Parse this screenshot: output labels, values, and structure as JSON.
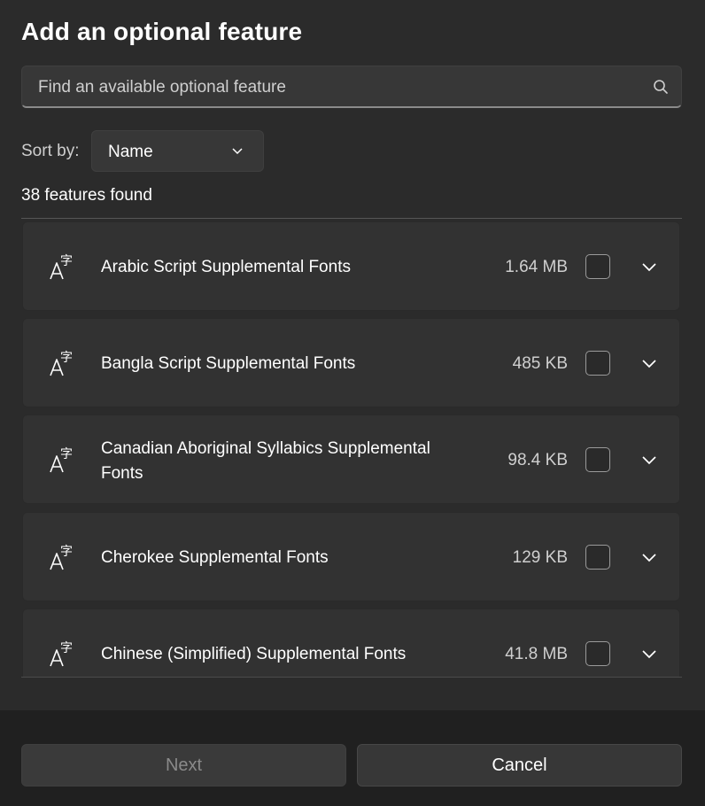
{
  "dialog": {
    "title": "Add an optional feature",
    "search": {
      "placeholder": "Find an available optional feature"
    },
    "sort": {
      "label": "Sort by:",
      "value": "Name"
    },
    "count_text": "38 features found"
  },
  "features": [
    {
      "name": "Arabic Script Supplemental Fonts",
      "size": "1.64 MB",
      "checked": false
    },
    {
      "name": "Bangla Script Supplemental Fonts",
      "size": "485 KB",
      "checked": false
    },
    {
      "name": "Canadian Aboriginal Syllabics Supplemental Fonts",
      "size": "98.4 KB",
      "checked": false
    },
    {
      "name": "Cherokee Supplemental Fonts",
      "size": "129 KB",
      "checked": false
    },
    {
      "name": "Chinese (Simplified) Supplemental Fonts",
      "size": "41.8 MB",
      "checked": false
    }
  ],
  "footer": {
    "next_label": "Next",
    "cancel_label": "Cancel"
  },
  "icons": {
    "feature": "font-language-icon",
    "search": "search-icon",
    "expand": "chevron-down-icon"
  },
  "colors": {
    "background": "#2b2b2b",
    "card": "#323232",
    "footer": "#202020"
  }
}
